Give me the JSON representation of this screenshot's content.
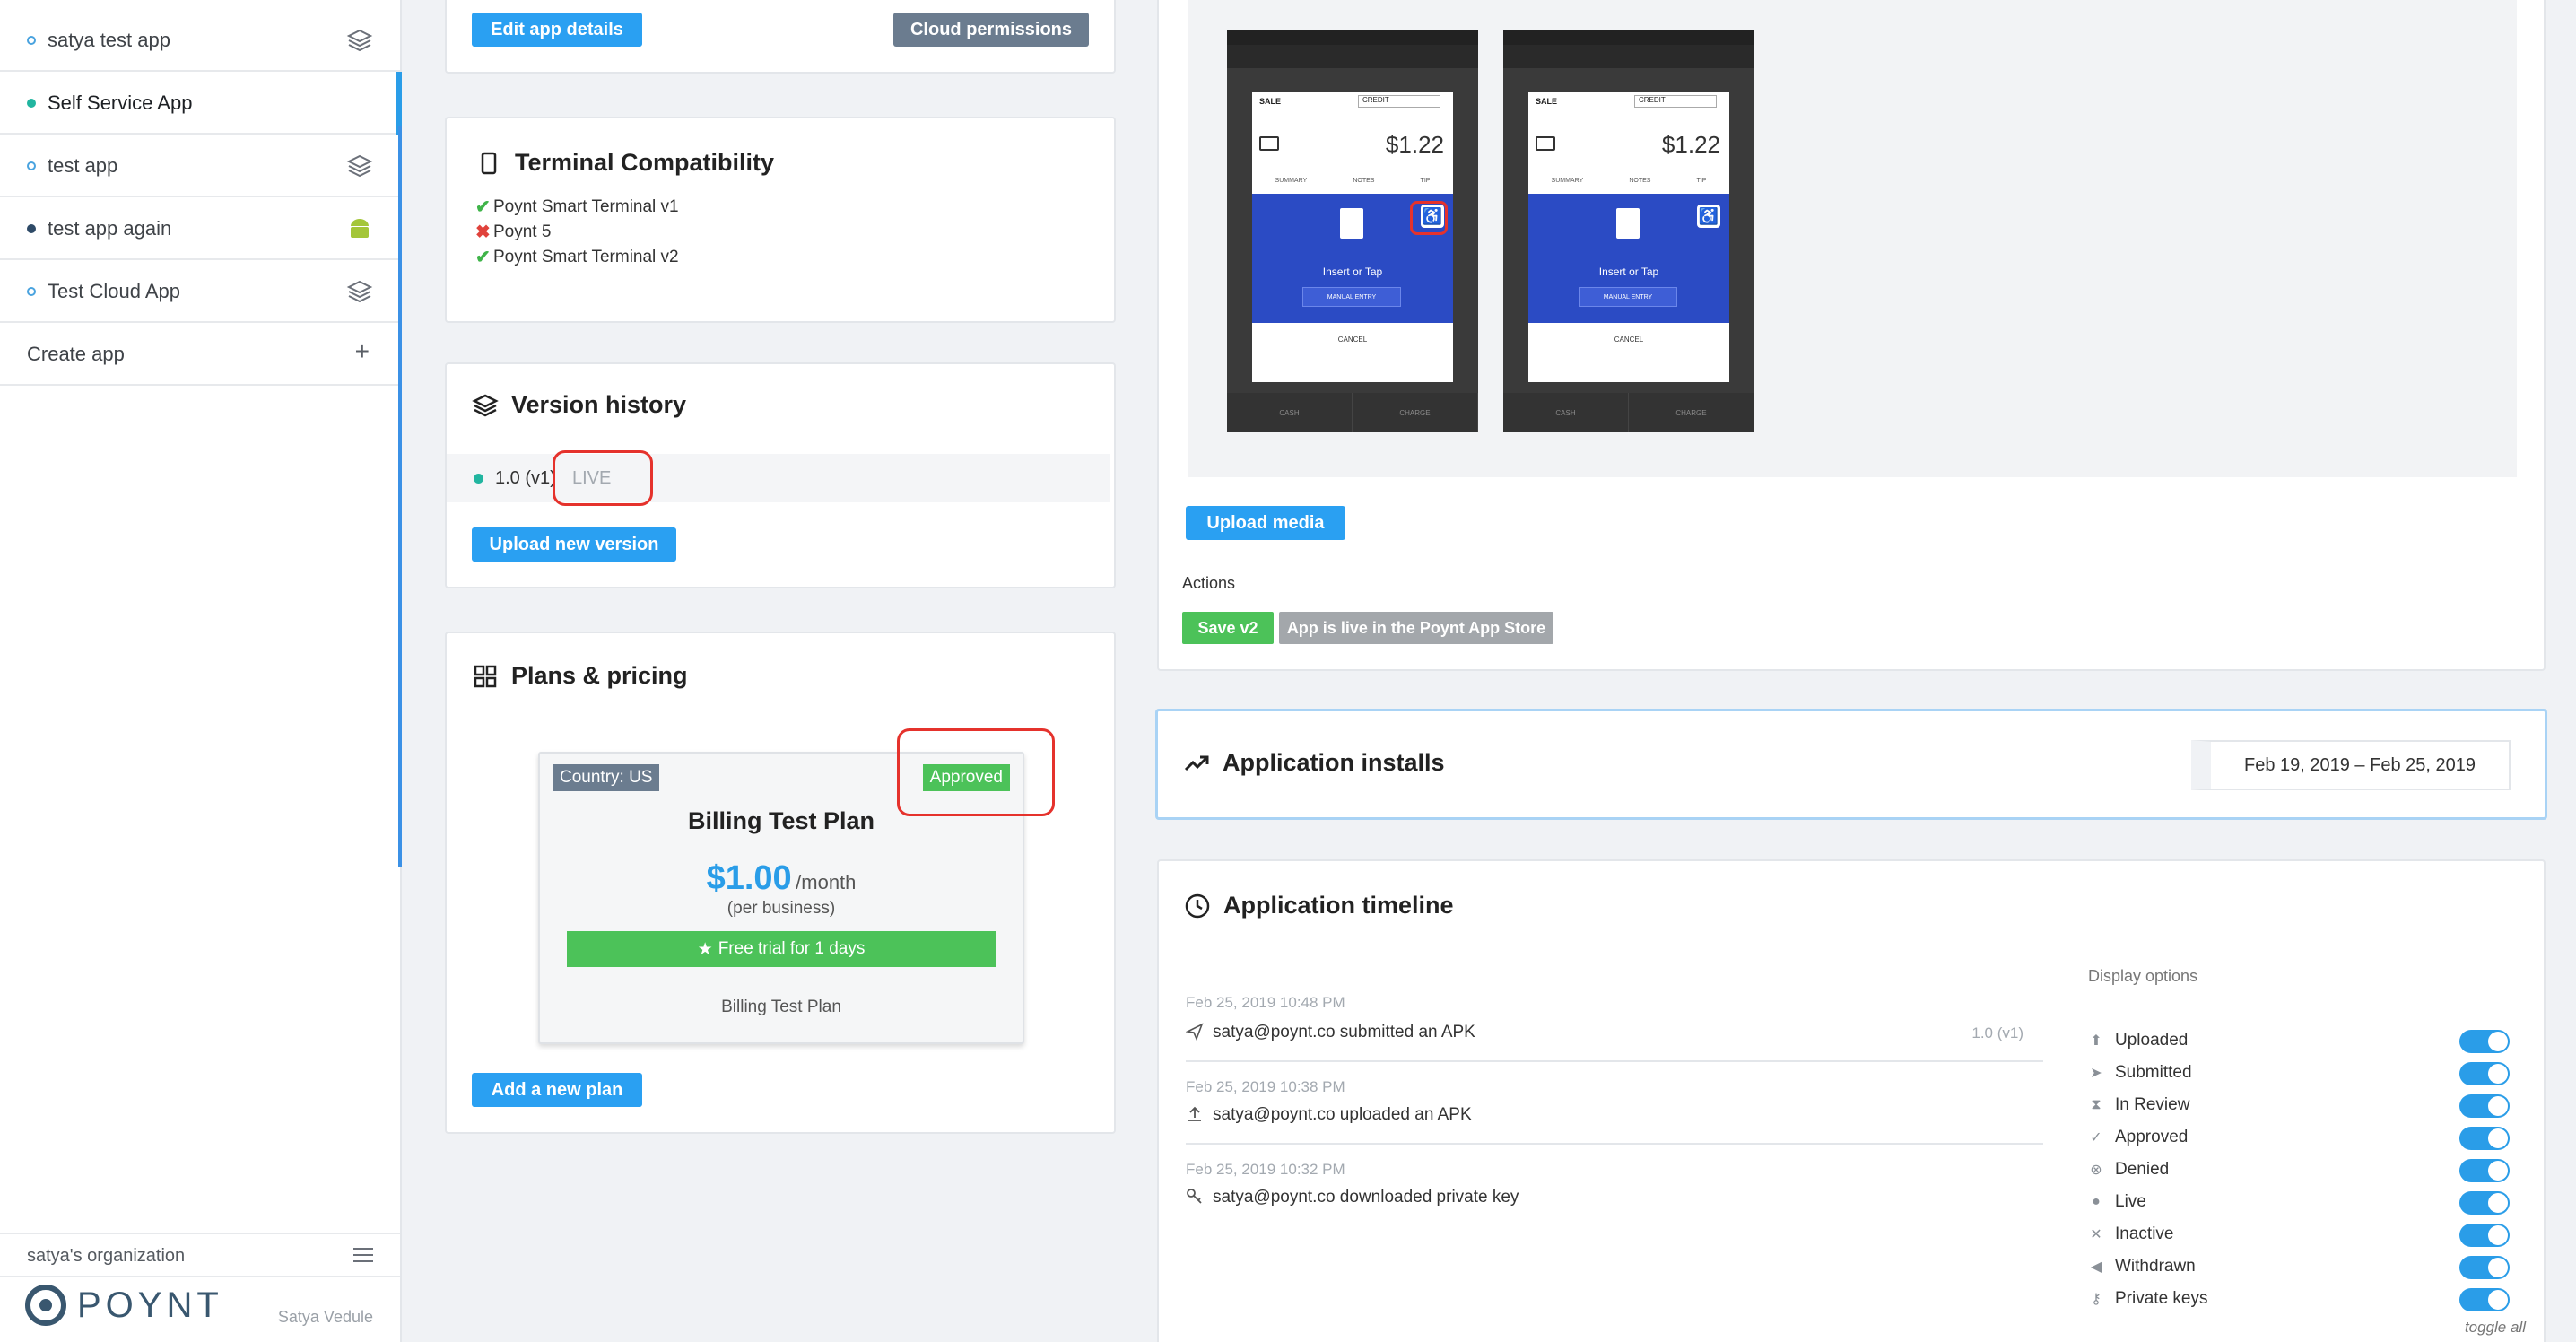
{
  "sidebar": {
    "items": [
      {
        "label": "satya test app",
        "icon": "layers-icon"
      },
      {
        "label": "Self Service App",
        "icon": ""
      },
      {
        "label": "test app",
        "icon": "layers-icon"
      },
      {
        "label": "test app again",
        "icon": "android-icon"
      },
      {
        "label": "Test Cloud App",
        "icon": "layers-icon"
      }
    ],
    "create_label": "Create app",
    "org_label": "satya's organization",
    "brand": "POYNT",
    "user": "Satya Vedule"
  },
  "app_details": {
    "edit_label": "Edit app details",
    "cloud_label": "Cloud permissions"
  },
  "compatibility": {
    "title": "Terminal Compatibility",
    "items": [
      {
        "name": "Poynt Smart Terminal v1",
        "ok": true
      },
      {
        "name": "Poynt 5",
        "ok": false
      },
      {
        "name": "Poynt Smart Terminal v2",
        "ok": true
      }
    ]
  },
  "version_history": {
    "title": "Version history",
    "version": "1.0 (v1)",
    "status": "LIVE",
    "upload_label": "Upload new version"
  },
  "plans": {
    "title": "Plans & pricing",
    "country": "Country: US",
    "status": "Approved",
    "plan_name": "Billing Test Plan",
    "price": "$1.00",
    "period": "/month",
    "basis": "(per business)",
    "trial": "Free trial for 1 days",
    "footer": "Billing Test Plan",
    "add_label": "Add a new plan"
  },
  "media": {
    "upload_label": "Upload media",
    "phone": {
      "sale": "SALE",
      "credit": "CREDIT",
      "amount": "$1.22",
      "tabs": [
        "SUMMARY",
        "NOTES",
        "TIP"
      ],
      "insert": "Insert or Tap",
      "manual": "MANUAL ENTRY",
      "cancel": "CANCEL",
      "bottom": [
        "CASH",
        "CHARGE"
      ]
    },
    "actions_label": "Actions",
    "save_label": "Save v2",
    "live_label": "App is live in the Poynt App Store"
  },
  "installs": {
    "title": "Application installs",
    "date_range": "Feb 19, 2019 – Feb 25, 2019"
  },
  "timeline": {
    "title": "Application timeline",
    "events": [
      {
        "date": "Feb 25, 2019 10:48 PM",
        "text": "satya@poynt.co submitted an APK",
        "version": "1.0 (v1)",
        "icon": "send-icon"
      },
      {
        "date": "Feb 25, 2019 10:38 PM",
        "text": "satya@poynt.co uploaded an APK",
        "version": "",
        "icon": "upload-icon"
      },
      {
        "date": "Feb 25, 2019 10:32 PM",
        "text": "satya@poynt.co downloaded private key",
        "version": "",
        "icon": "key-icon"
      }
    ],
    "display_options_label": "Display options",
    "options": [
      {
        "label": "Uploaded",
        "icon": "upload-icon",
        "glyph": "⬆"
      },
      {
        "label": "Submitted",
        "icon": "send-icon",
        "glyph": "➤"
      },
      {
        "label": "In Review",
        "icon": "hourglass-icon",
        "glyph": "⧗"
      },
      {
        "label": "Approved",
        "icon": "check-circle-icon",
        "glyph": "✓"
      },
      {
        "label": "Denied",
        "icon": "denied-icon",
        "glyph": "⊗"
      },
      {
        "label": "Live",
        "icon": "globe-icon",
        "glyph": "●"
      },
      {
        "label": "Inactive",
        "icon": "x-icon",
        "glyph": "✕"
      },
      {
        "label": "Withdrawn",
        "icon": "rewind-icon",
        "glyph": "◀"
      },
      {
        "label": "Private keys",
        "icon": "key-icon",
        "glyph": "⚷"
      }
    ],
    "toggle_all": "toggle all"
  },
  "colors": {
    "accent": "#2aa0f2",
    "success": "#4cc259",
    "neutral": "#6b7c8f",
    "highlight": "#e5322c"
  }
}
